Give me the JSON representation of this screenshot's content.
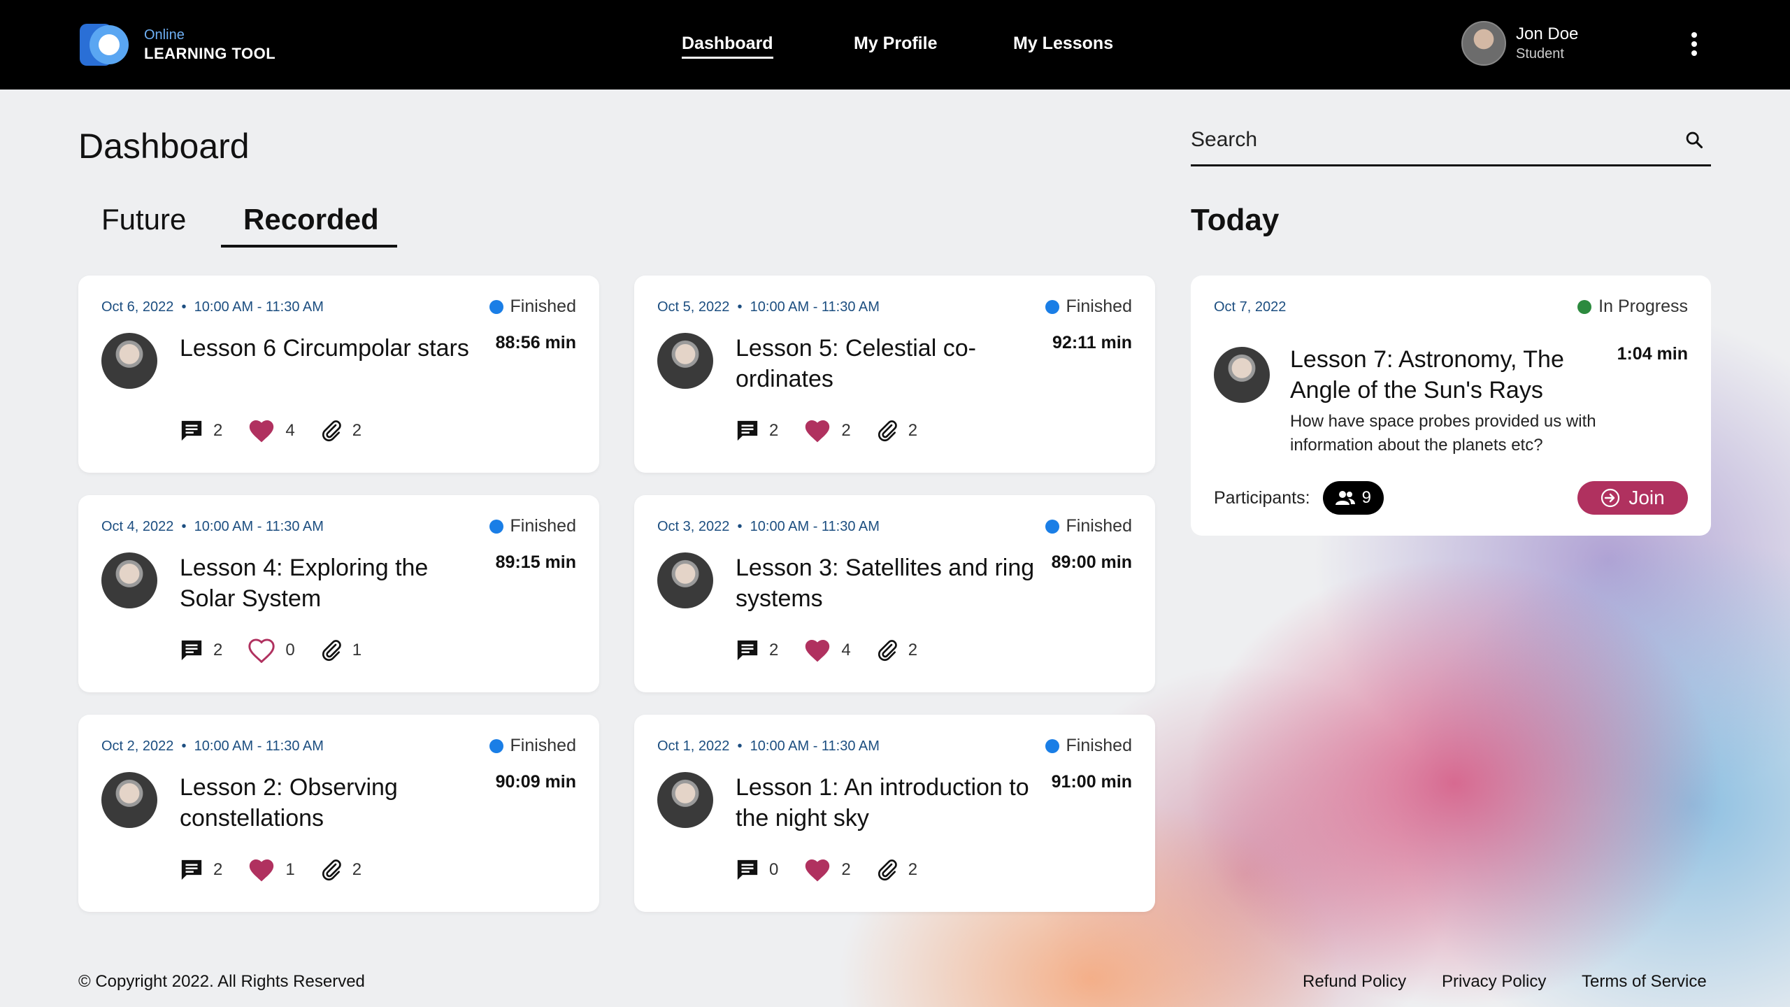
{
  "brand": {
    "small": "Online",
    "big": "LEARNING TOOL"
  },
  "nav": [
    {
      "label": "Dashboard",
      "active": true
    },
    {
      "label": "My Profile",
      "active": false
    },
    {
      "label": "My Lessons",
      "active": false
    }
  ],
  "user": {
    "name": "Jon Doe",
    "role": "Student"
  },
  "page": {
    "title": "Dashboard"
  },
  "tabs": {
    "future": "Future",
    "recorded": "Recorded",
    "active": "Recorded"
  },
  "search": {
    "placeholder": "Search"
  },
  "today": {
    "heading": "Today",
    "date": "Oct 7, 2022",
    "status": "In Progress",
    "title": "Lesson 7: Astronomy, The Angle of the Sun's Rays",
    "duration": "1:04 min",
    "description": "How have space probes provided us with information about the planets etc?",
    "participants_label": "Participants:",
    "participants_count": "9",
    "join_label": "Join"
  },
  "lessons": [
    {
      "date": "Oct 6, 2022",
      "time": "10:00 AM - 11:30 AM",
      "status": "Finished",
      "title": "Lesson 6 Circumpolar stars",
      "duration": "88:56 min",
      "comments": "2",
      "likes": "4",
      "liked": true,
      "attachments": "2"
    },
    {
      "date": "Oct 5, 2022",
      "time": "10:00 AM - 11:30 AM",
      "status": "Finished",
      "title": "Lesson 5: Celestial co-ordinates",
      "duration": "92:11 min",
      "comments": "2",
      "likes": "2",
      "liked": true,
      "attachments": "2"
    },
    {
      "date": "Oct 4, 2022",
      "time": "10:00 AM - 11:30 AM",
      "status": "Finished",
      "title": "Lesson 4: Exploring the Solar System",
      "duration": "89:15 min",
      "comments": "2",
      "likes": "0",
      "liked": false,
      "attachments": "1"
    },
    {
      "date": "Oct 3, 2022",
      "time": "10:00 AM - 11:30 AM",
      "status": "Finished",
      "title": "Lesson 3: Satellites and ring systems",
      "duration": "89:00 min",
      "comments": "2",
      "likes": "4",
      "liked": true,
      "attachments": "2"
    },
    {
      "date": "Oct 2, 2022",
      "time": "10:00 AM - 11:30 AM",
      "status": "Finished",
      "title": "Lesson 2: Observing constellations",
      "duration": "90:09 min",
      "comments": "2",
      "likes": "1",
      "liked": true,
      "attachments": "2"
    },
    {
      "date": "Oct 1, 2022",
      "time": "10:00 AM - 11:30 AM",
      "status": "Finished",
      "title": "Lesson 1: An introduction to the night sky",
      "duration": "91:00 min",
      "comments": "0",
      "likes": "2",
      "liked": true,
      "attachments": "2"
    }
  ],
  "footer": {
    "copyright": "© Copyright 2022. All Rights Reserved",
    "links": [
      "Refund Policy",
      "Privacy Policy",
      "Terms of Service"
    ]
  },
  "colors": {
    "accent": "#b0315f",
    "status_finished": "#1a7ee6",
    "status_in_progress": "#2c8a3e",
    "header_bg": "#000000"
  },
  "icons": [
    "logo-icon",
    "search-icon",
    "kebab-menu-icon",
    "comment-icon",
    "heart-icon",
    "paperclip-icon",
    "participants-icon",
    "join-icon"
  ]
}
